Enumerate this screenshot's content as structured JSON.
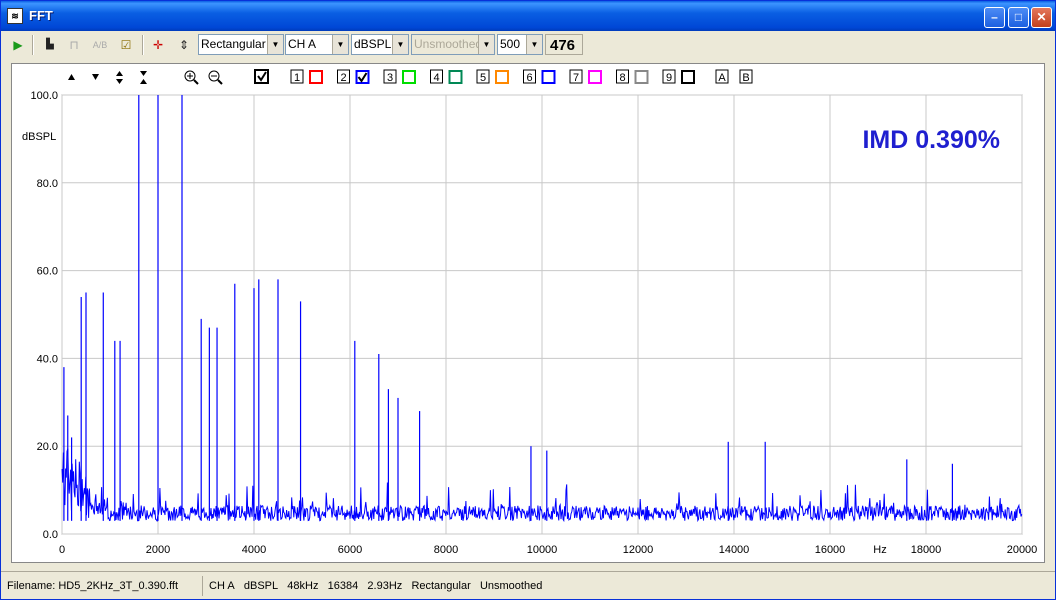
{
  "window": {
    "title": "FFT",
    "app_icon": "fft-app-icon",
    "controls": [
      "minimize-icon",
      "maximize-icon",
      "close-icon"
    ]
  },
  "toolbar": {
    "window_function": "Rectangular",
    "channel": "CH A",
    "units": "dBSPL",
    "smoothing": "Unsmoothed",
    "averages": "500",
    "counter": "476"
  },
  "plot_toolbar": {
    "channel_toggles": [
      "1",
      "2",
      "3",
      "4",
      "5",
      "6",
      "7",
      "8",
      "9"
    ],
    "channel_colors": [
      "#ff0000",
      "#0000ff",
      "#00dd00",
      "#008855",
      "#ff8800",
      "#0000ff",
      "#ff00ff",
      "#888888",
      "#000000"
    ],
    "channel_checked": [
      false,
      true,
      false,
      false,
      false,
      false,
      false,
      false,
      false
    ],
    "markers": [
      "A",
      "B"
    ]
  },
  "annotation": "IMD 0.390%",
  "chart_data": {
    "type": "line",
    "title": "",
    "xlabel": "Hz",
    "ylabel": "dBSPL",
    "xlim": [
      0,
      20000
    ],
    "ylim": [
      0,
      100
    ],
    "x_ticks": [
      "0",
      "2000",
      "4000",
      "6000",
      "8000",
      "10000",
      "12000",
      "14000",
      "16000",
      "18000",
      "20000"
    ],
    "y_ticks": [
      "0.0",
      "20.0",
      "40.0",
      "60.0",
      "80.0",
      "100.0"
    ],
    "grid": true,
    "series_color": "#0000ff",
    "noise_floor": 3,
    "peaks": [
      {
        "x": 40,
        "y": 38
      },
      {
        "x": 120,
        "y": 27
      },
      {
        "x": 200,
        "y": 22
      },
      {
        "x": 400,
        "y": 54
      },
      {
        "x": 500,
        "y": 55
      },
      {
        "x": 860,
        "y": 55
      },
      {
        "x": 1100,
        "y": 44
      },
      {
        "x": 1210,
        "y": 44
      },
      {
        "x": 1600,
        "y": 100
      },
      {
        "x": 2000,
        "y": 100
      },
      {
        "x": 2500,
        "y": 100
      },
      {
        "x": 2900,
        "y": 49
      },
      {
        "x": 3070,
        "y": 47
      },
      {
        "x": 3230,
        "y": 47
      },
      {
        "x": 3600,
        "y": 57
      },
      {
        "x": 4000,
        "y": 56
      },
      {
        "x": 4100,
        "y": 58
      },
      {
        "x": 4500,
        "y": 58
      },
      {
        "x": 4970,
        "y": 53
      },
      {
        "x": 6100,
        "y": 44
      },
      {
        "x": 6600,
        "y": 41
      },
      {
        "x": 6800,
        "y": 33
      },
      {
        "x": 7000,
        "y": 31
      },
      {
        "x": 7450,
        "y": 28
      },
      {
        "x": 9770,
        "y": 20
      },
      {
        "x": 10100,
        "y": 19
      },
      {
        "x": 13880,
        "y": 21
      },
      {
        "x": 14650,
        "y": 21
      },
      {
        "x": 17600,
        "y": 17
      },
      {
        "x": 18550,
        "y": 16
      }
    ]
  },
  "status": {
    "filename": "Filename: HD5_2KHz_3T_0.390.fft",
    "channel": "CH A",
    "units": "dBSPL",
    "sample_rate": "48kHz",
    "fft_size": "16384",
    "resolution": "2.93Hz",
    "window": "Rectangular",
    "smoothing": "Unsmoothed"
  }
}
